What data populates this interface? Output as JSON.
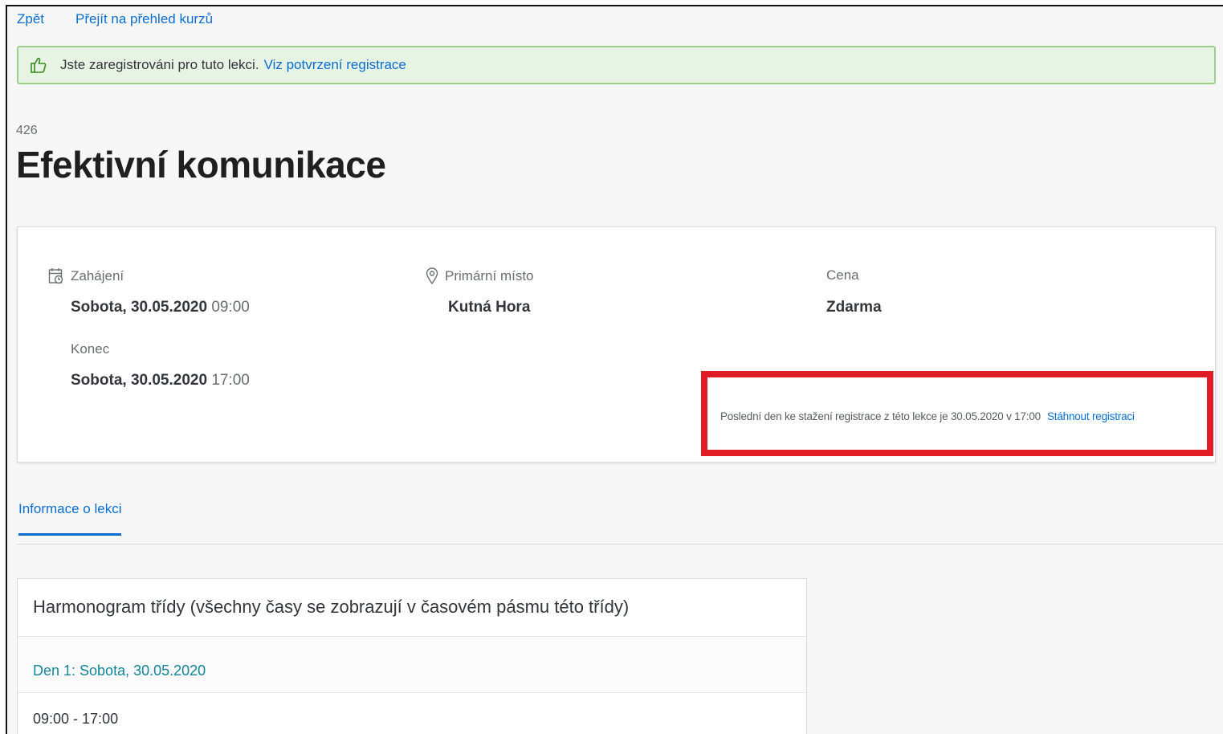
{
  "nav": {
    "back": "Zpět",
    "overview": "Přejít na přehled kurzů"
  },
  "message": {
    "icon": "thumbs-up-icon",
    "text": "Jste zaregistrováni pro tuto lekci.",
    "link": "Viz potvrzení registrace",
    "color": "#9ad08b"
  },
  "course": {
    "number": "426",
    "title": "Efektivní komunikace"
  },
  "details": {
    "start": {
      "icon": "calendar-icon",
      "label": "Zahájení",
      "date": "Sobota, 30.05.2020",
      "time": "09:00"
    },
    "end": {
      "label": "Konec",
      "date": "Sobota, 30.05.2020",
      "time": "17:00"
    },
    "location": {
      "icon": "location-pin-icon",
      "label": "Primární místo",
      "value": "Kutná Hora"
    },
    "price": {
      "label": "Cena",
      "value": "Zdarma"
    }
  },
  "withdraw": {
    "text": "Poslední den ke stažení registrace z této lekce je 30.05.2020 v 17:00",
    "link": "Stáhnout registraci",
    "highlight_color": "#e01c24"
  },
  "tabs": [
    {
      "label": "Informace o lekci",
      "active": true
    }
  ],
  "schedule": {
    "title": "Harmonogram třídy (všechny časy se zobrazují v časovém pásmu této třídy)",
    "day": "Den 1: Sobota, 30.05.2020",
    "time": "09:00 - 17:00"
  },
  "colors": {
    "link": "#0a6ed1",
    "day_heading": "#128599"
  }
}
